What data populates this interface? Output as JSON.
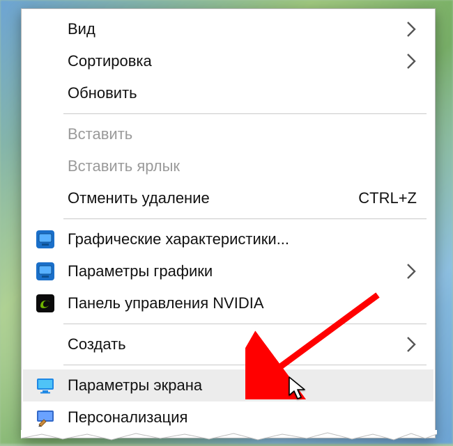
{
  "menu": {
    "items": [
      {
        "label": "Вид",
        "submenu": true
      },
      {
        "label": "Сортировка",
        "submenu": true
      },
      {
        "label": "Обновить"
      },
      {
        "label": "Вставить",
        "disabled": true
      },
      {
        "label": "Вставить ярлык",
        "disabled": true
      },
      {
        "label": "Отменить удаление",
        "shortcut": "CTRL+Z"
      },
      {
        "label": "Графические характеристики...",
        "icon": "intel-graphics"
      },
      {
        "label": "Параметры графики",
        "icon": "intel-graphics",
        "submenu": true
      },
      {
        "label": "Панель управления NVIDIA",
        "icon": "nvidia"
      },
      {
        "label": "Создать",
        "submenu": true
      },
      {
        "label": "Параметры экрана",
        "icon": "display-settings",
        "hover": true
      },
      {
        "label": "Персонализация",
        "icon": "personalization"
      }
    ]
  },
  "annotation": {
    "arrow_color": "#ff0000",
    "highlight_target": "Параметры экрана"
  }
}
